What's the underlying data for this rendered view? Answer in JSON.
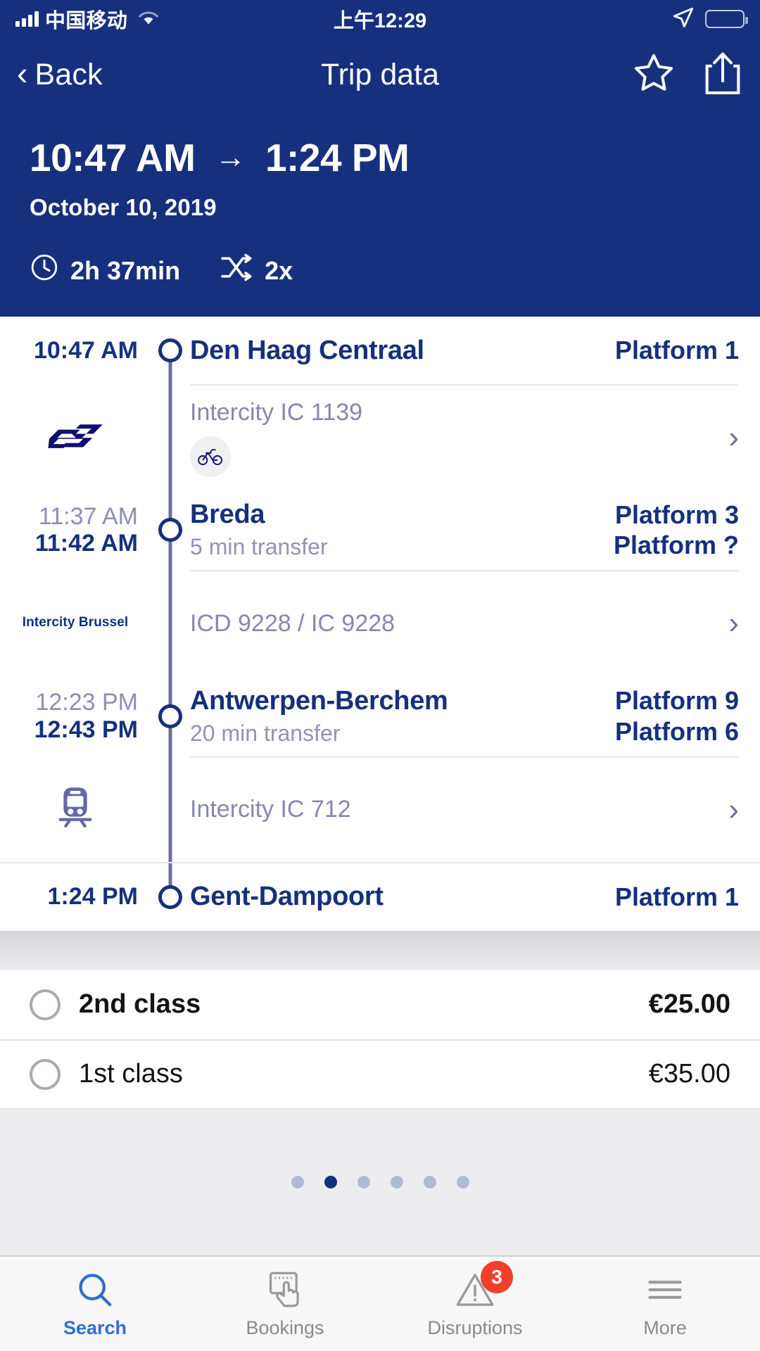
{
  "status_bar": {
    "carrier": "中国移动",
    "time": "上午12:29",
    "signal_icon": "signal-bars-icon",
    "wifi_icon": "wifi-icon",
    "location_icon": "location-arrow-icon",
    "battery_icon": "battery-low-icon",
    "battery_color": "#F14A3A"
  },
  "nav_bar": {
    "back_label": "Back",
    "title": "Trip data",
    "favorite_icon": "star-icon",
    "share_icon": "share-icon"
  },
  "trip_header": {
    "depart_time": "10:47 AM",
    "arrow": "→",
    "arrive_time": "1:24 PM",
    "date": "October 10, 2019",
    "duration": "2h 37min",
    "transfers": "2x",
    "clock_icon": "clock-icon",
    "transfer_icon": "transfer-shuffle-icon",
    "background_color": "#16307D"
  },
  "timeline": {
    "stops": [
      {
        "id": "origin",
        "time_depart": "10:47 AM",
        "time_arrive": "",
        "station": "Den Haag Centraal",
        "transfer_note": "",
        "platform_arrive": "",
        "platform_depart": "Platform 1"
      },
      {
        "id": "breda",
        "time_arrive": "11:37 AM",
        "time_depart": "11:42 AM",
        "station": "Breda",
        "transfer_note": "5 min transfer",
        "platform_arrive": "Platform 3",
        "platform_depart": "Platform ?"
      },
      {
        "id": "antwerpen",
        "time_arrive": "12:23 PM",
        "time_depart": "12:43 PM",
        "station": "Antwerpen-Berchem",
        "transfer_note": "20 min transfer",
        "platform_arrive": "Platform 9",
        "platform_depart": "Platform 6"
      },
      {
        "id": "destination",
        "time_depart": "1:24 PM",
        "time_arrive": "",
        "station": "Gent-Dampoort",
        "transfer_note": "",
        "platform_arrive": "",
        "platform_depart": "Platform 1"
      }
    ],
    "legs": [
      {
        "id": "leg1",
        "service": "Intercity IC 1139",
        "operator_icon": "ns-logo-icon",
        "operator_label": "",
        "facility_icon": "bicycle-icon",
        "chevron": "›"
      },
      {
        "id": "leg2",
        "service": "ICD 9228 / IC 9228",
        "operator_icon": "text-label",
        "operator_label": "Intercity Brussel",
        "facility_icon": "",
        "chevron": "›"
      },
      {
        "id": "leg3",
        "service": "Intercity IC 712",
        "operator_icon": "train-front-icon",
        "operator_label": "",
        "facility_icon": "",
        "chevron": "›"
      }
    ]
  },
  "fares": {
    "options": [
      {
        "id": "second",
        "label": "2nd class",
        "price": "€25.00",
        "selected": false,
        "emphasized": true
      },
      {
        "id": "first",
        "label": "1st class",
        "price": "€35.00",
        "selected": false,
        "emphasized": false
      }
    ],
    "radio_icon": "radio-unselected-icon"
  },
  "pager": {
    "total_dots": 6,
    "active_index": 1,
    "active_color": "#14307B",
    "inactive_color": "#AFBBD2"
  },
  "tab_bar": {
    "tabs": [
      {
        "id": "search",
        "label": "Search",
        "icon": "search-icon",
        "active": true,
        "badge": ""
      },
      {
        "id": "bookings",
        "label": "Bookings",
        "icon": "hand-tap-card-icon",
        "active": false,
        "badge": ""
      },
      {
        "id": "disruptions",
        "label": "Disruptions",
        "icon": "warning-triangle-icon",
        "active": false,
        "badge": "3"
      },
      {
        "id": "more",
        "label": "More",
        "icon": "hamburger-menu-icon",
        "active": false,
        "badge": ""
      }
    ],
    "badge_color": "#F0402B",
    "active_color": "#2F6FD0"
  }
}
